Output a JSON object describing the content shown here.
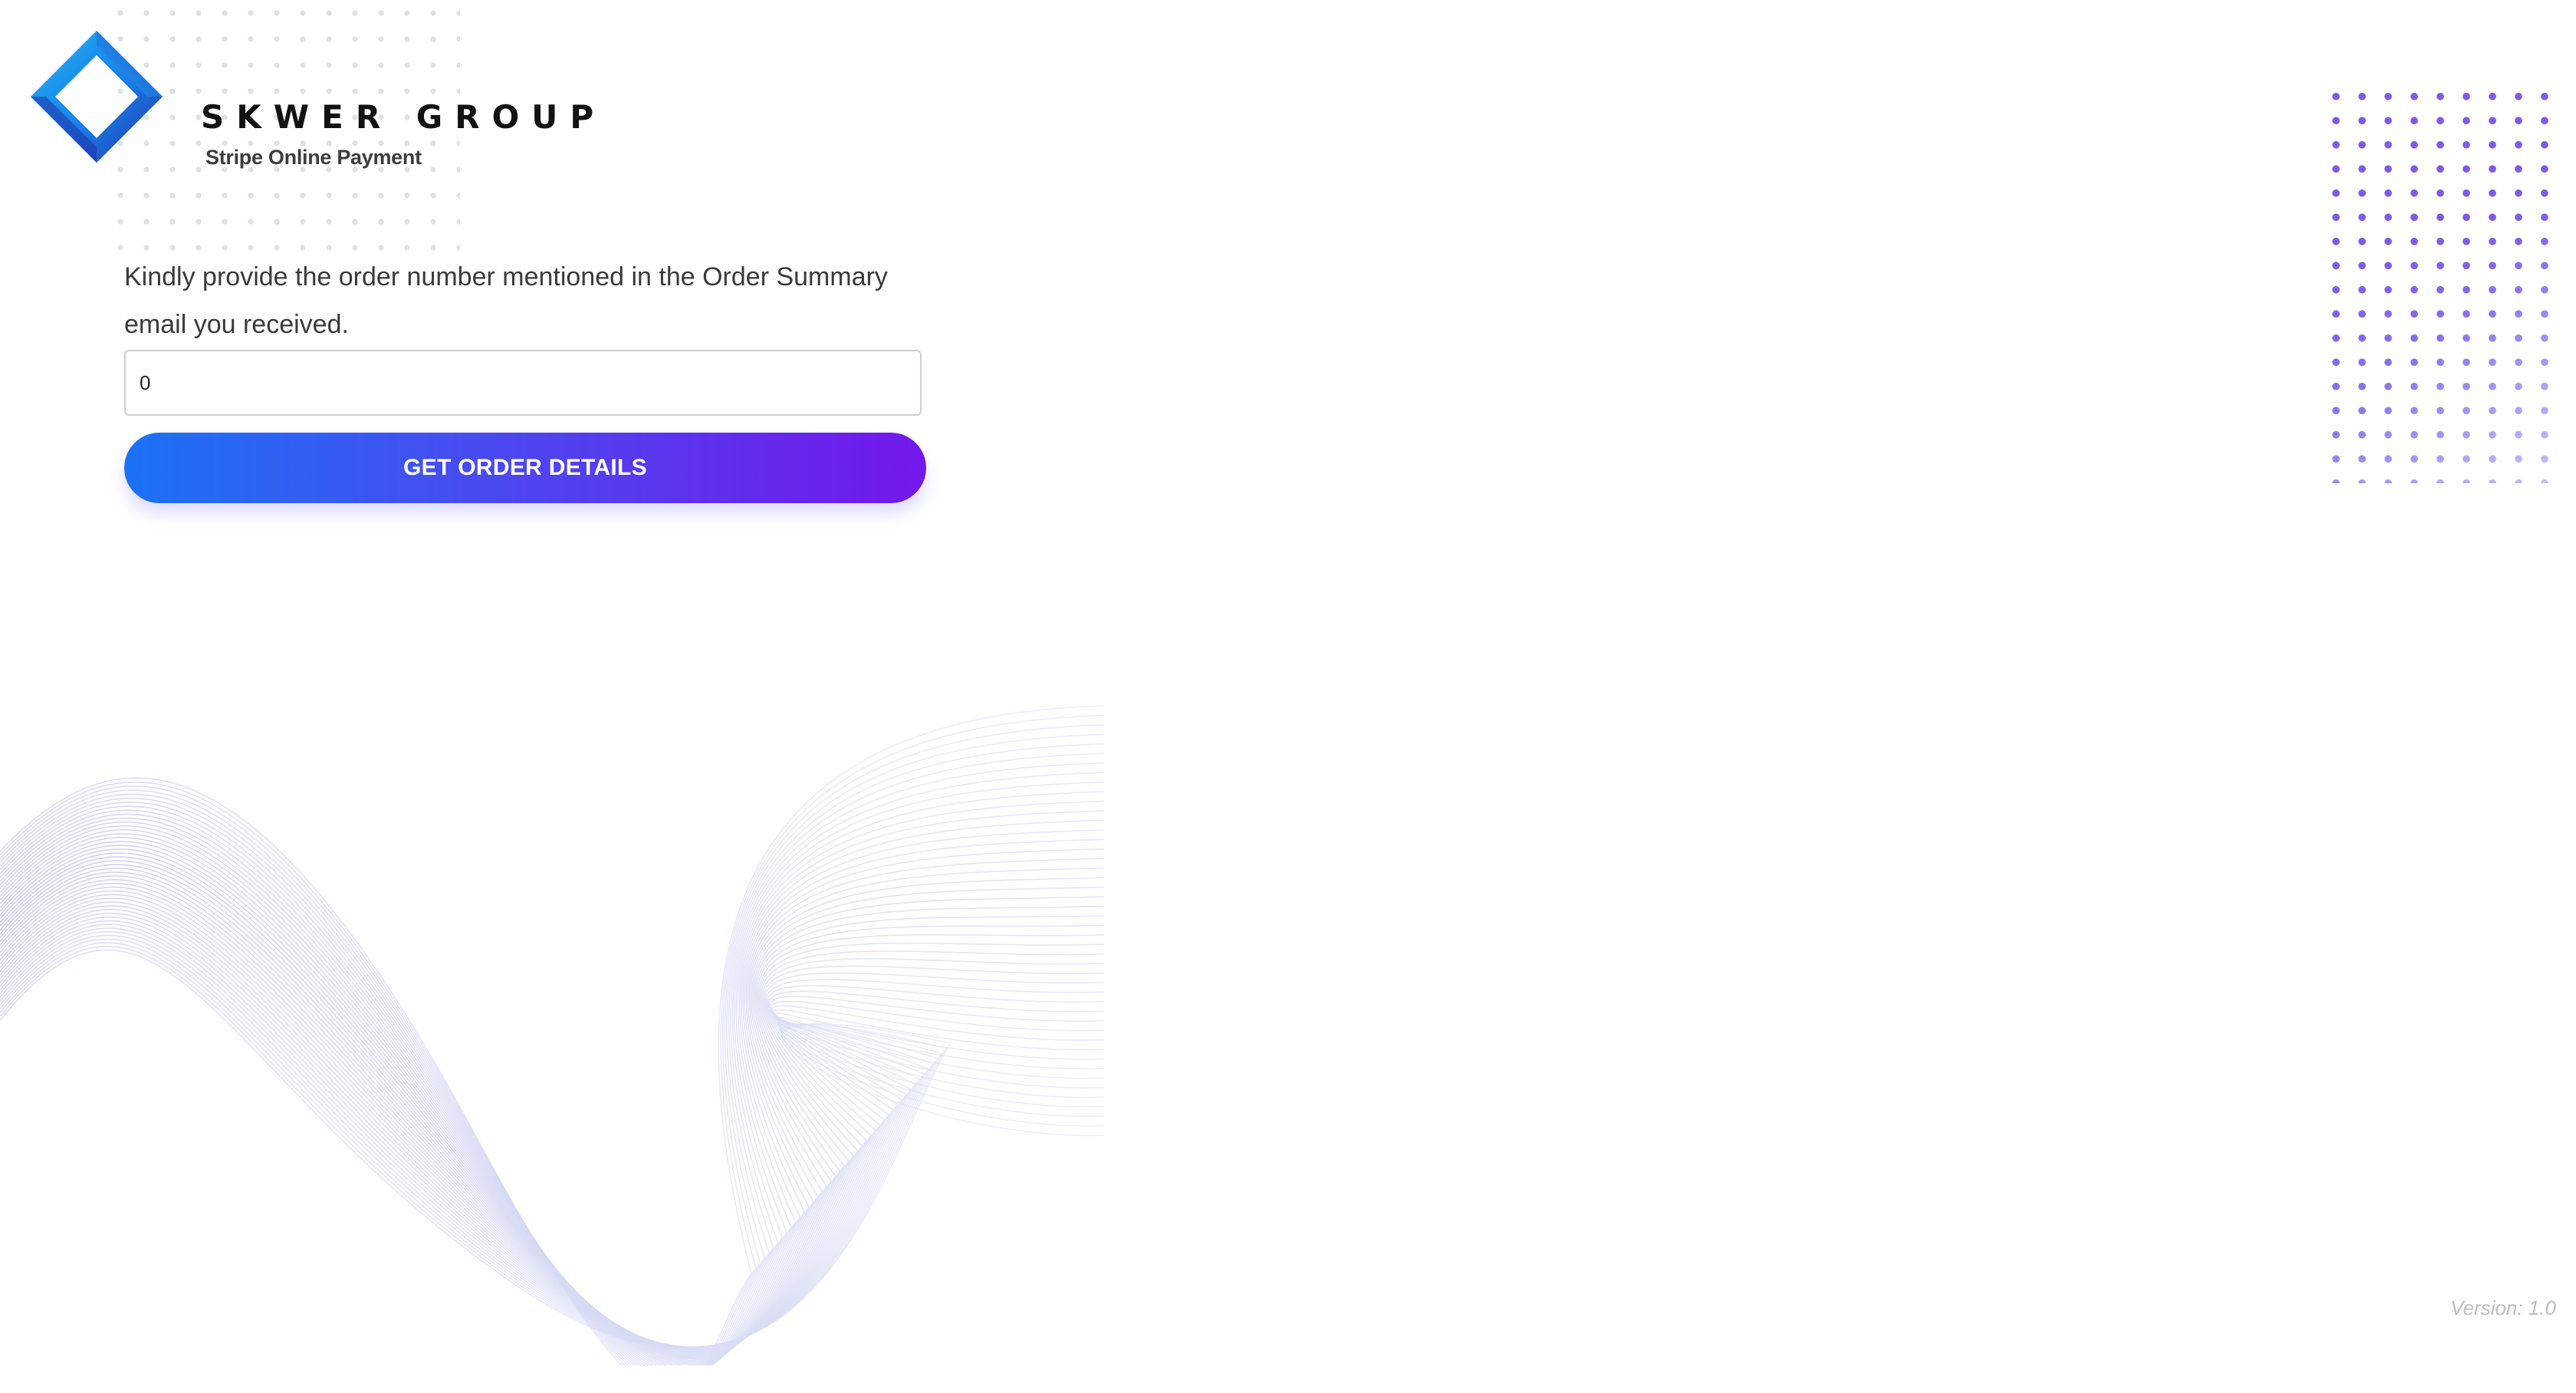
{
  "brand": {
    "title": "SKWER GROUP",
    "subtitle": "Stripe Online Payment"
  },
  "form": {
    "prompt": "Kindly provide the order number mentioned in the Order Summary email you received.",
    "order_number_value": "0",
    "submit_label": "GET ORDER DETAILS"
  },
  "footer": {
    "version": "Version: 1.0"
  },
  "colors": {
    "button_start": "#1b72f5",
    "button_end": "#7317eb",
    "logo_blue": "#1a8cf0",
    "logo_navy": "#1f2ea8",
    "dot_accent": "#7f5ae6"
  }
}
